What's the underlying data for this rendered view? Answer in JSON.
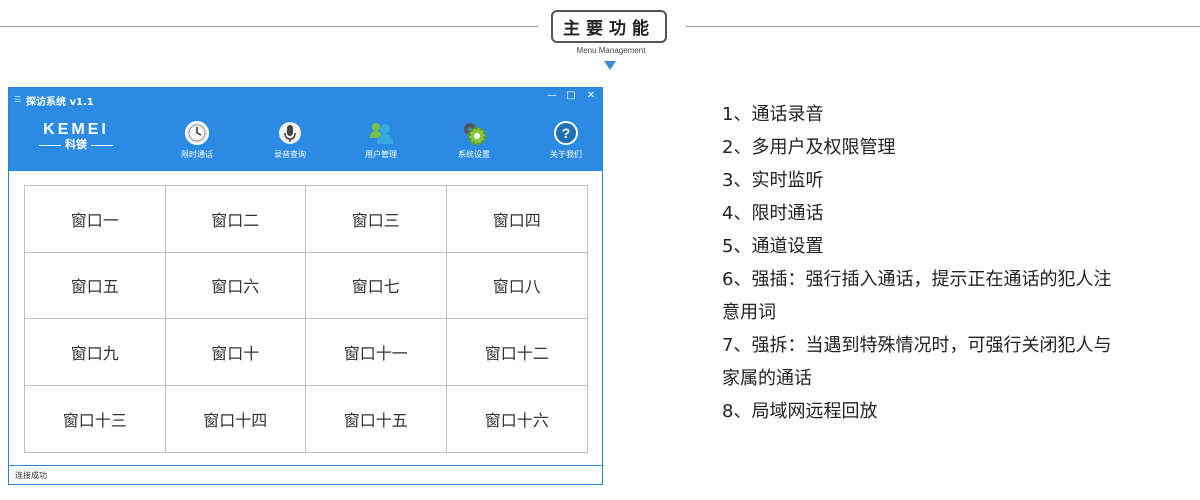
{
  "header": {
    "title": "主要功能",
    "subtitle": "Menu Management"
  },
  "window": {
    "title": "探访系统 v1.1",
    "controls": {
      "minimize": "—",
      "maximize": "□",
      "close": "✕"
    },
    "logo": {
      "main": "KEMEI",
      "sub": "科镁"
    },
    "toolbar": [
      {
        "label": "限时通话",
        "icon": "clock-icon"
      },
      {
        "label": "录音查询",
        "icon": "microphone-icon"
      },
      {
        "label": "用户管理",
        "icon": "users-icon"
      },
      {
        "label": "系统设置",
        "icon": "gear-icon"
      },
      {
        "label": "关于我们",
        "icon": "help-icon"
      }
    ],
    "windows": [
      "窗口一",
      "窗口二",
      "窗口三",
      "窗口四",
      "窗口五",
      "窗口六",
      "窗口七",
      "窗口八",
      "窗口九",
      "窗口十",
      "窗口十一",
      "窗口十二",
      "窗口十三",
      "窗口十四",
      "窗口十五",
      "窗口十六"
    ],
    "status": "连接成功"
  },
  "features": [
    "1、通话录音",
    "2、多用户及权限管理",
    "3、实时监听",
    "4、限时通话",
    "5、通道设置",
    "6、强插：强行插入通话，提示正在通话的犯人注",
    "意用词",
    "7、强拆：当遇到特殊情况时，可强行关闭犯人与",
    "家属的通话",
    "8、局域网远程回放"
  ],
  "colors": {
    "accent": "#2b8be3",
    "arrow": "#3a8ad6"
  }
}
